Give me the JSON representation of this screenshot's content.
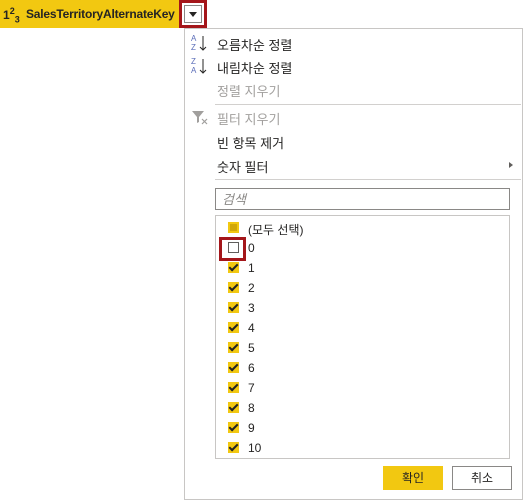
{
  "column": {
    "type_icon": "1²₃",
    "name": "SalesTerritoryAlternateKey",
    "filter_icon": "chevron-down-icon"
  },
  "menu": {
    "sort_asc": "오름차순 정렬",
    "sort_desc": "내림차순 정렬",
    "clear_sort": "정렬 지우기",
    "clear_filter": "필터 지우기",
    "remove_empty": "빈 항목 제거",
    "number_filters": "숫자 필터"
  },
  "search": {
    "placeholder": "검색"
  },
  "values": {
    "select_all": "(모두 선택)",
    "items": [
      "0",
      "1",
      "2",
      "3",
      "4",
      "5",
      "6",
      "7",
      "8",
      "9",
      "10"
    ]
  },
  "buttons": {
    "ok": "확인",
    "cancel": "취소"
  },
  "colors": {
    "accent": "#f2c811",
    "highlight": "#a4161a"
  }
}
